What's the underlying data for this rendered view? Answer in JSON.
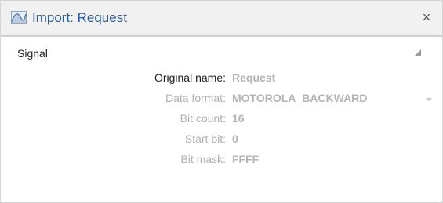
{
  "window": {
    "title": "Import: Request",
    "close_label": "×"
  },
  "section": {
    "title": "Signal"
  },
  "fields": {
    "original_name": {
      "label": "Original name:",
      "value": "Request"
    },
    "data_format": {
      "label": "Data format:",
      "value": "MOTOROLA_BACKWARD"
    },
    "bit_count": {
      "label": "Bit count:",
      "value": "16"
    },
    "start_bit": {
      "label": "Start bit:",
      "value": "0"
    },
    "bit_mask": {
      "label": "Bit mask:",
      "value": "FFFF"
    }
  },
  "colors": {
    "title_text": "#2a5f9e",
    "active_label": "#1e1e1e",
    "disabled_text": "#b4b4b4"
  },
  "icons": {
    "title_icon": "signal-waveform-icon",
    "collapse_icon": "collapse-triangle-icon",
    "dropdown_icon": "chevron-down-icon"
  }
}
